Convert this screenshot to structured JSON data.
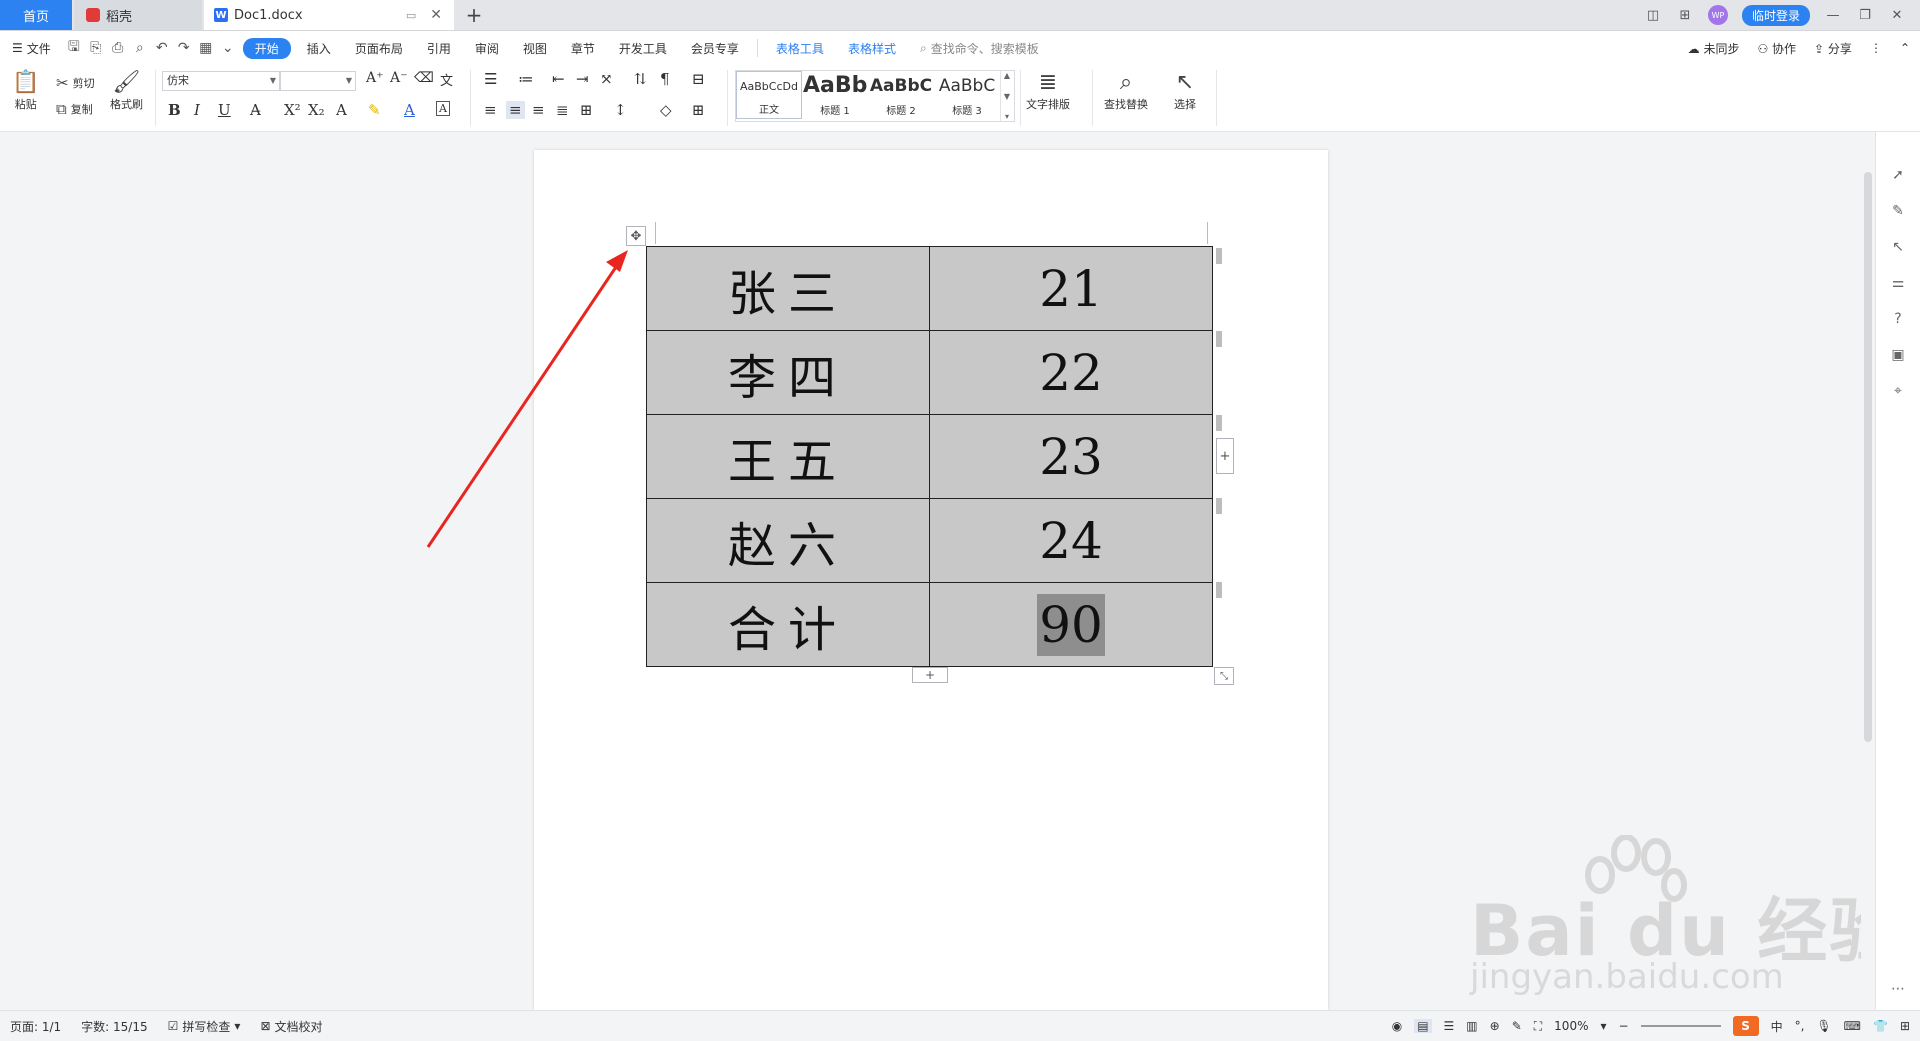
{
  "titlebar": {
    "tabs": [
      {
        "label": "首页"
      },
      {
        "label": "稻壳"
      },
      {
        "label": "Doc1.docx"
      }
    ],
    "login_label": "临时登录",
    "avatar_text": "WP"
  },
  "menubar": {
    "file_label": "文件",
    "items": [
      "开始",
      "插入",
      "页面布局",
      "引用",
      "审阅",
      "视图",
      "章节",
      "开发工具",
      "会员专享"
    ],
    "context_items": [
      "表格工具",
      "表格样式"
    ],
    "search_placeholder": "查找命令、搜索模板",
    "right": {
      "sync": "未同步",
      "collab": "协作",
      "share": "分享"
    }
  },
  "ribbon": {
    "paste": "粘贴",
    "cut": "剪切",
    "copy": "复制",
    "format_painter": "格式刷",
    "font_name": "仿宋",
    "font_size": "",
    "styles": [
      {
        "sample": "AaBbCcDd",
        "label": "正文"
      },
      {
        "sample": "AaBb",
        "label": "标题 1"
      },
      {
        "sample": "AaBbC",
        "label": "标题 2"
      },
      {
        "sample": "AaBbC",
        "label": "标题 3"
      }
    ],
    "text_layout": "文字排版",
    "find_replace": "查找替换",
    "select": "选择"
  },
  "table": {
    "rows": [
      {
        "name": "张三",
        "value": "21"
      },
      {
        "name": "李四",
        "value": "22"
      },
      {
        "name": "王五",
        "value": "23"
      },
      {
        "name": "赵六",
        "value": "24"
      },
      {
        "name": "合计",
        "value": "90"
      }
    ]
  },
  "watermark": {
    "brand": "Bai du 经验",
    "url": "jingyan.baidu.com"
  },
  "status": {
    "page": "页面: 1/1",
    "words": "字数: 15/15",
    "spell": "拼写检查",
    "proof": "文档校对",
    "zoom": "100%",
    "ime": "中"
  },
  "colors": {
    "accent": "#2c82f0",
    "cell_fill": "#c8c8c8",
    "selection": "#8e8e8e",
    "arrow": "#e8261f"
  }
}
